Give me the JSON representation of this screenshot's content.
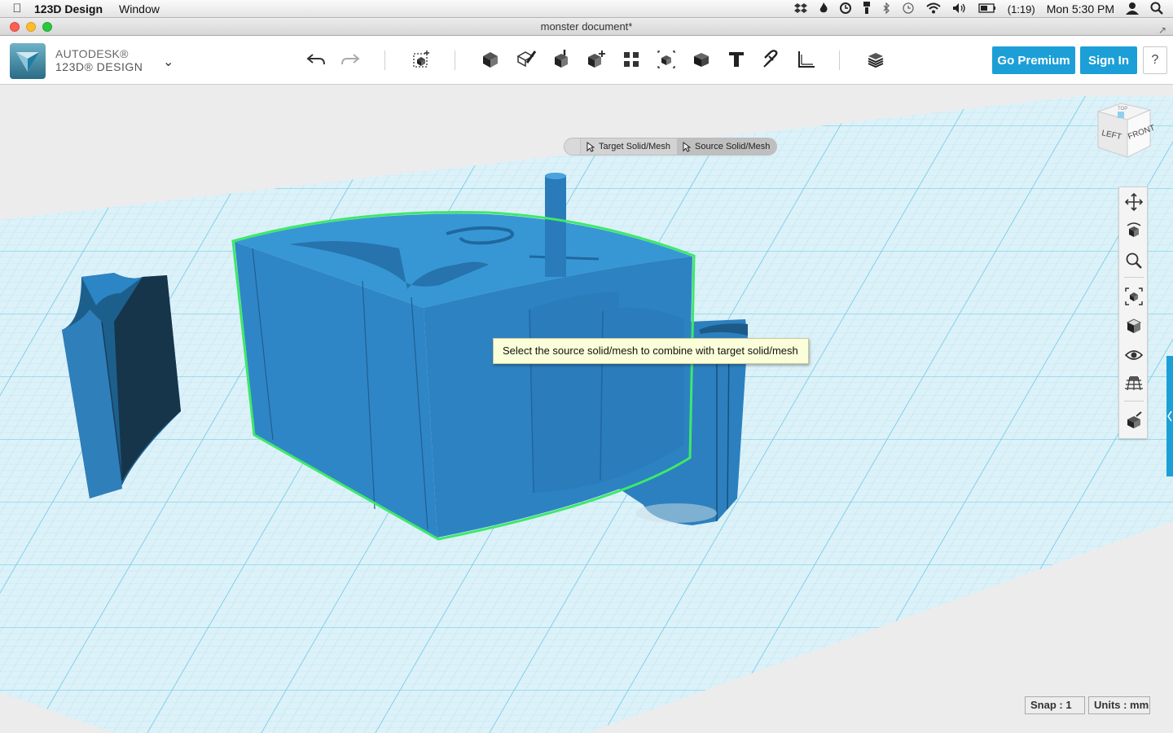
{
  "menubar": {
    "app_name": "123D Design",
    "menus": [
      "Window"
    ],
    "battery": "(1:19)",
    "clock": "Mon 5:30 PM"
  },
  "window": {
    "title": "monster document*"
  },
  "toolbar": {
    "brand_line1": "AUTODESK®",
    "brand_line2": "123D® DESIGN",
    "go_premium_label": "Go Premium",
    "sign_in_label": "Sign In",
    "help_label": "?",
    "tools": [
      "undo-icon",
      "redo-icon",
      "transform-icon",
      "primitives-icon",
      "sketch-icon",
      "construct-icon",
      "modify-icon",
      "pattern-icon",
      "group-icon",
      "combine-icon",
      "text-icon",
      "snap-icon",
      "measure-icon",
      "material-icon"
    ]
  },
  "combine_tool": {
    "target_label": "Target Solid/Mesh",
    "source_label": "Source Solid/Mesh",
    "active": "source"
  },
  "tooltip": {
    "text": "Select the source solid/mesh to combine with target solid/mesh"
  },
  "viewcube": {
    "left_label": "LEFT",
    "front_label": "FRONT",
    "top_label": "TOP"
  },
  "nav_tools": [
    "pan-icon",
    "orbit-icon",
    "zoom-icon",
    "fit-icon",
    "views-icon",
    "visibility-icon",
    "grid-icon",
    "material-view-icon"
  ],
  "status": {
    "snap": "Snap : 1",
    "units": "Units : mm"
  },
  "colors": {
    "accent": "#1c9fd6",
    "model_blue": "#2f86c6",
    "selection_green": "#3ee86a",
    "grid_line": "#7fd0ea",
    "tooltip_bg": "#fbffd9"
  }
}
